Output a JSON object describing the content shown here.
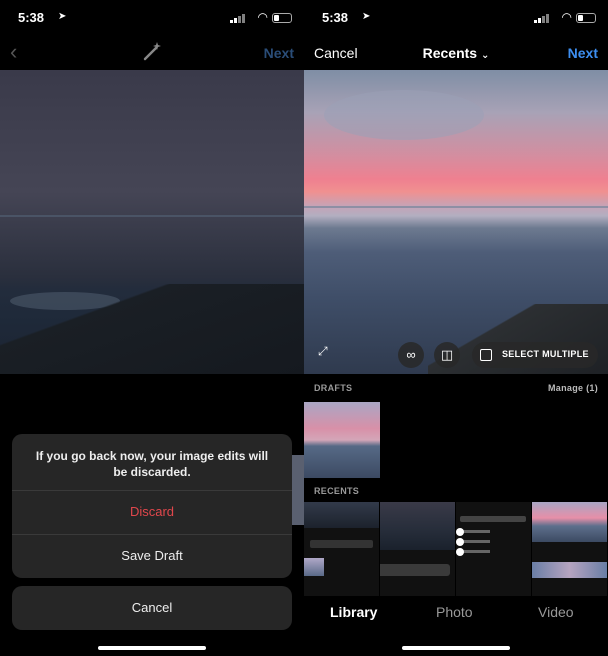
{
  "status": {
    "time": "5:38"
  },
  "left": {
    "back_icon": "chevron-left-icon",
    "edit_icon": "magic-wand-icon",
    "next_label": "Next",
    "dialog": {
      "message": "If you go back now, your image edits will be discarded.",
      "discard_label": "Discard",
      "save_draft_label": "Save Draft",
      "cancel_label": "Cancel"
    }
  },
  "right": {
    "cancel_label": "Cancel",
    "title": "Recents",
    "next_label": "Next",
    "select_multiple_label": "SELECT MULTIPLE",
    "drafts_label": "DRAFTS",
    "manage_label": "Manage (1)",
    "recents_label": "RECENTS",
    "tabs": [
      "Library",
      "Photo",
      "Video"
    ]
  },
  "colors": {
    "accent_blue": "#3d8ef0",
    "discard_red": "#e0474c",
    "sheet_bg": "#262626"
  }
}
